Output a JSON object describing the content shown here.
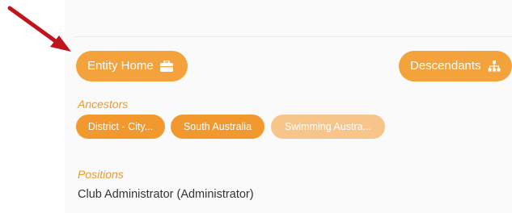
{
  "header": {
    "entity_home_label": "Entity Home",
    "entity_home_icon": "briefcase-icon",
    "descendants_label": "Descendants",
    "descendants_icon": "sitemap-icon"
  },
  "ancestors": {
    "label": "Ancestors",
    "items": [
      {
        "label": "District - City...",
        "enabled": true
      },
      {
        "label": "South Australia",
        "enabled": true
      },
      {
        "label": "Swimming Austra...",
        "enabled": false
      }
    ]
  },
  "positions": {
    "label": "Positions",
    "items": [
      "Club Administrator (Administrator)"
    ]
  },
  "annotation": {
    "arrow_icon": "pointer-arrow-icon"
  },
  "colors": {
    "accent": "#f4a23c",
    "accent_disabled": "#f7c58a",
    "label_accent": "#e89a2e",
    "arrow": "#c0151c"
  }
}
